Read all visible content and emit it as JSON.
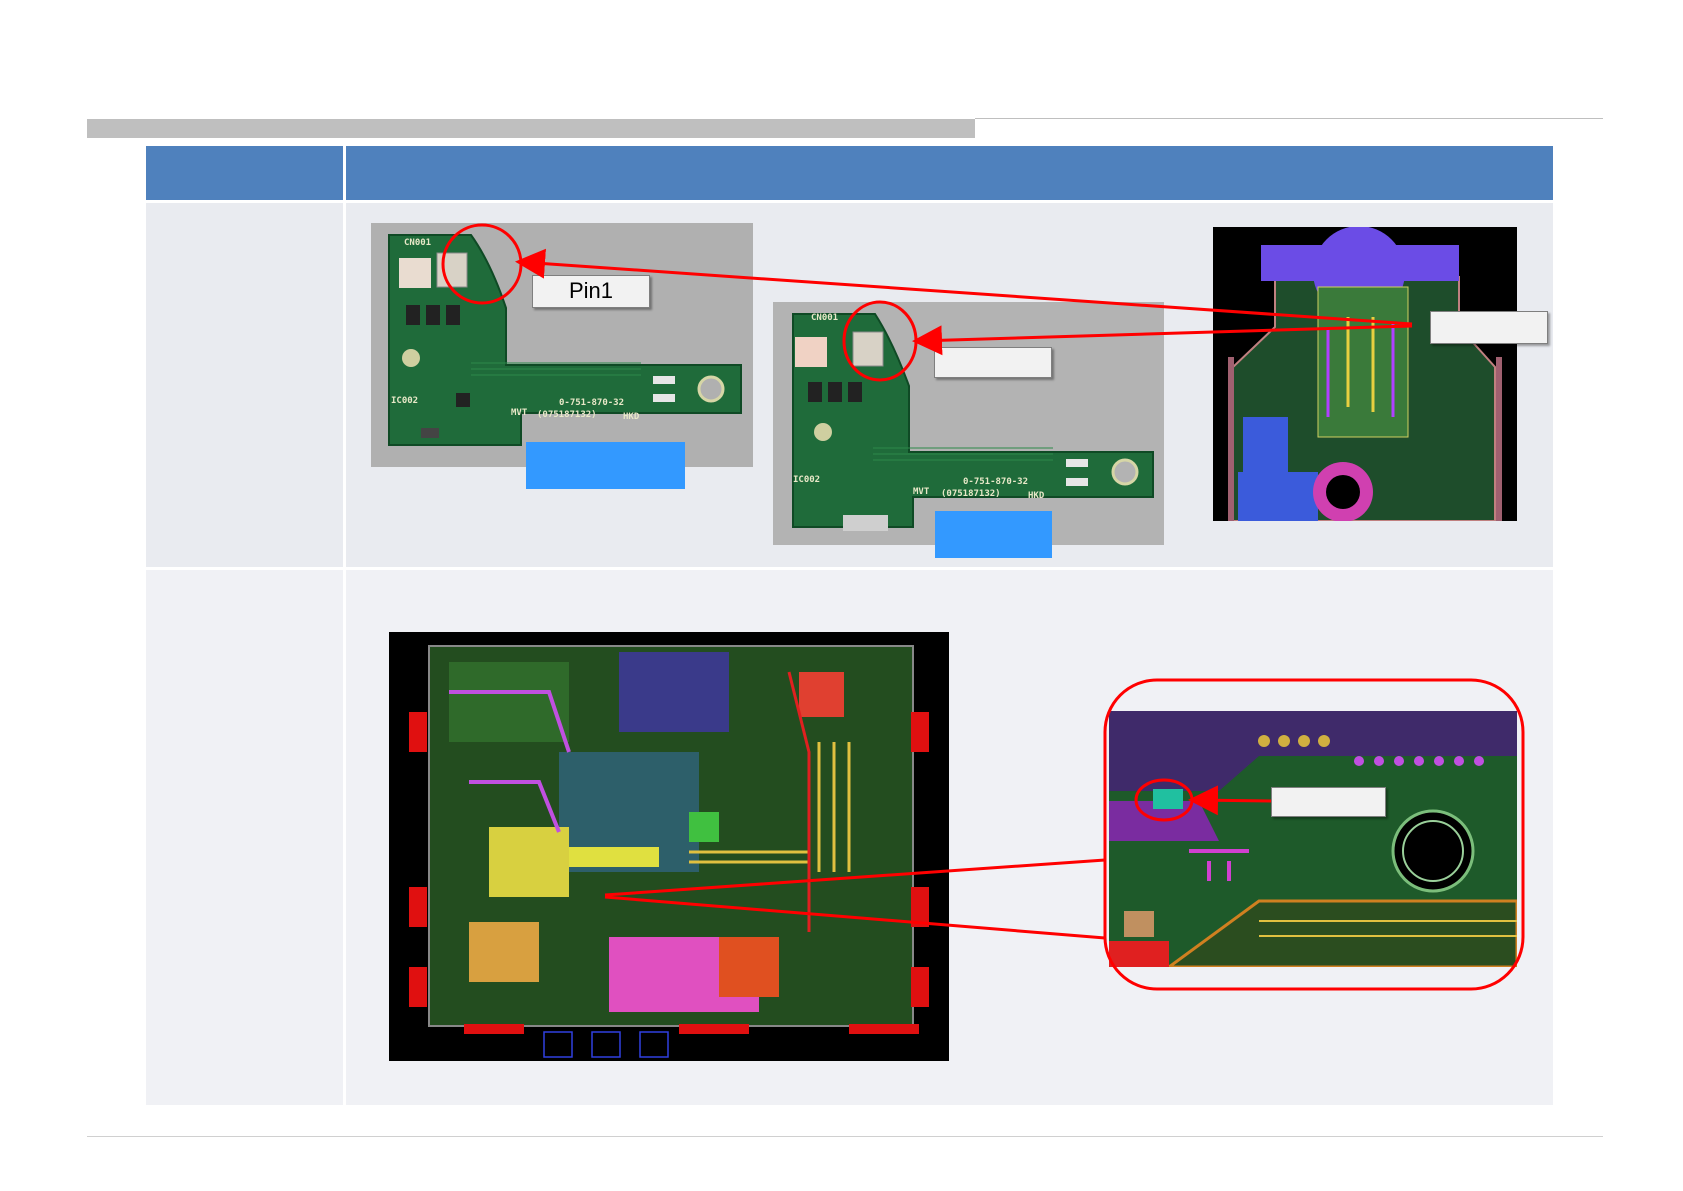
{
  "slide": {
    "callouts": {
      "pin1": "Pin1"
    },
    "colors": {
      "header_fill": "#4f81bd",
      "row1_fill": "#e9ebf0",
      "row2_fill": "#f0f1f5",
      "blue_label": "#3399ff",
      "annotation_red": "#ff0000",
      "pcb_green": "#1f6b3a",
      "layout_black": "#000000"
    },
    "images": [
      {
        "name": "pcb-photo-top",
        "kind": "photo",
        "board_silkscreen": [
          "CN001",
          "IC002",
          "0-751-870-32",
          "(075187132)",
          "MVT",
          "HKD"
        ]
      },
      {
        "name": "pcb-photo-bottom",
        "kind": "photo",
        "board_silkscreen": [
          "CN001",
          "IC002",
          "0-751-870-32",
          "(075187132)",
          "MVT",
          "HKD"
        ]
      },
      {
        "name": "pcb-layout-closeup",
        "kind": "cad-layout"
      },
      {
        "name": "pcb-layout-main",
        "kind": "cad-layout"
      },
      {
        "name": "pcb-layout-zoom",
        "kind": "cad-layout"
      }
    ]
  }
}
